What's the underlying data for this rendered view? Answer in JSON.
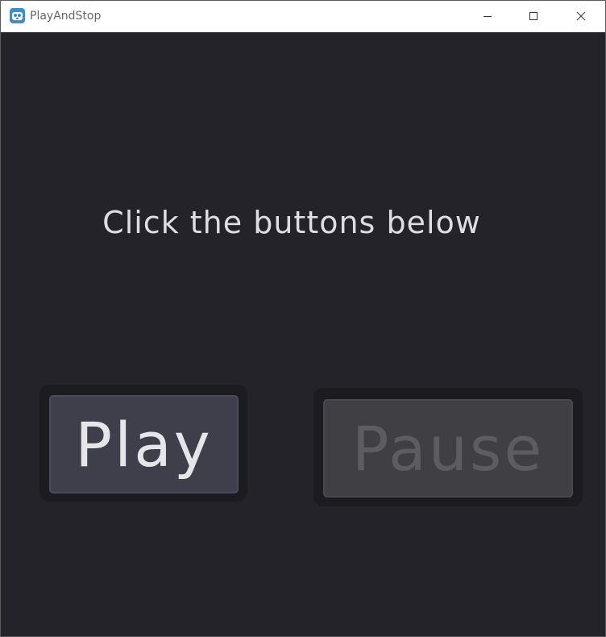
{
  "window": {
    "title": "PlayAndStop",
    "icon": "godot-engine-icon",
    "controls": {
      "minimize": "minimize-icon",
      "maximize": "maximize-icon",
      "close": "close-icon"
    }
  },
  "main": {
    "instruction": "Click the buttons below",
    "play_button": {
      "label": "Play",
      "enabled": true
    },
    "pause_button": {
      "label": "Pause",
      "enabled": false
    }
  },
  "colors": {
    "background": "#242329",
    "button_enabled": "#3f3e4b",
    "button_disabled": "#403f44",
    "text": "#dedee2",
    "text_disabled": "#5d5c61"
  }
}
